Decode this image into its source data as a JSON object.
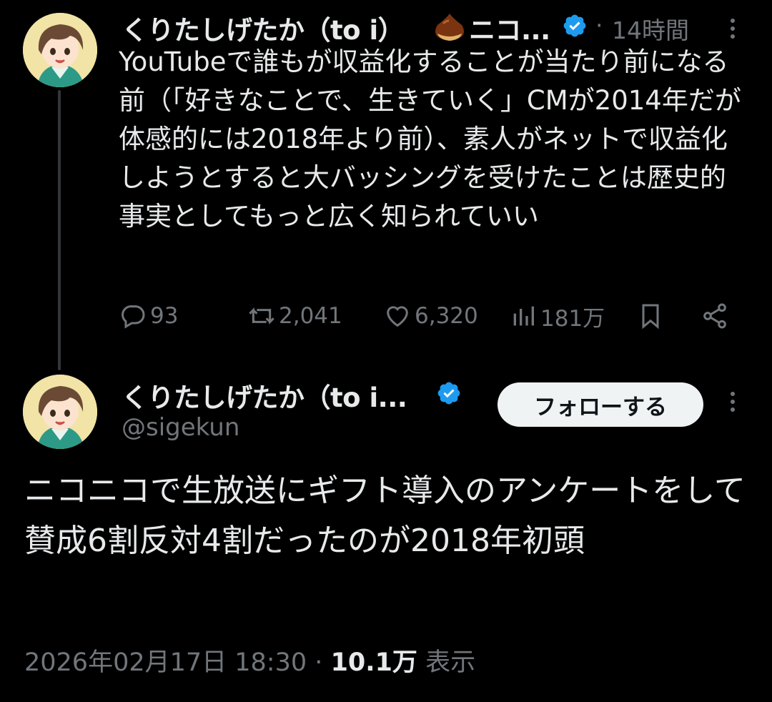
{
  "parent_tweet": {
    "display_name": "くりたしげたか（to i）",
    "display_name_suffix": "ニコ...",
    "separator": "·",
    "time": "14時間",
    "text": "YouTubeで誰もが収益化することが当たり前になる前（「好きなことで、生きていく」CMが2014年だが体感的には2018年より前）、素人がネットで収益化しようとすると大バッシングを受けたことは歴史的事実としてもっと広く知られていい",
    "replies": "93",
    "reposts": "2,041",
    "likes": "6,320",
    "views": "181万"
  },
  "main_tweet": {
    "display_name": "くりたしげたか（to i...",
    "handle": "@sigekun",
    "follow_label": "フォローする",
    "text": "ニコニコで生放送にギフト導入のアンケートをして賛成6割反対4割だったのが2018年初頭",
    "date": "2026年02月17日 18:30",
    "separator": "·",
    "views_count": "10.1万",
    "views_label": "表示"
  },
  "icons": {
    "verified": "verified-badge-icon",
    "chestnut": "chestnut-emoji-icon",
    "reply": "reply-icon",
    "repost": "repost-icon",
    "like": "heart-icon",
    "views": "analytics-icon",
    "bookmark": "bookmark-icon",
    "share": "share-icon",
    "more": "more-options-icon"
  },
  "colors": {
    "background": "#000000",
    "text_primary": "#e7e9ea",
    "text_secondary": "#71767b",
    "verified_blue": "#1d9bf0",
    "follow_button_bg": "#eff3f4"
  }
}
